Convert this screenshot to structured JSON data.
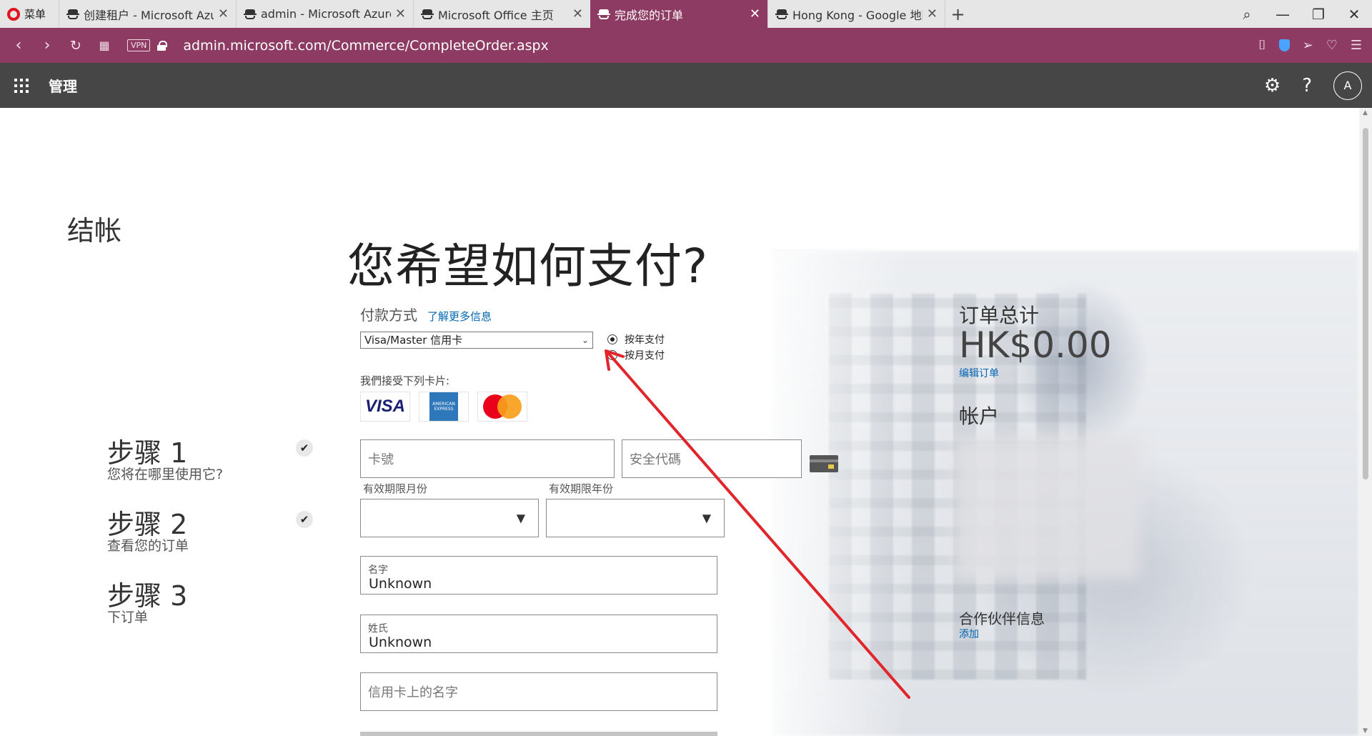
{
  "browser": {
    "menu_label": "菜单",
    "tabs": [
      {
        "title": "创建租户 - Microsoft Azure",
        "active": false
      },
      {
        "title": "admin - Microsoft Azure",
        "active": false
      },
      {
        "title": "Microsoft Office 主页",
        "active": false
      },
      {
        "title": "完成您的订单",
        "active": true
      },
      {
        "title": "Hong Kong - Google 地图",
        "active": false
      }
    ],
    "vpn_label": "VPN",
    "url": "admin.microsoft.com/Commerce/CompleteOrder.aspx",
    "accent_color": "#8e3b63"
  },
  "admin_header": {
    "title": "管理",
    "avatar_initial": "A",
    "background_color": "#464646"
  },
  "checkout": {
    "title": "结帐",
    "steps": [
      {
        "label": "步骤 1",
        "desc": "您将在哪里使用它?",
        "completed": true
      },
      {
        "label": "步骤 2",
        "desc": "查看您的订单",
        "completed": true
      },
      {
        "label": "步骤 3",
        "desc": "下订单",
        "completed": false
      }
    ]
  },
  "payment": {
    "question": "您希望如何支付?",
    "method_label": "付款方式",
    "learn_more": "了解更多信息",
    "method_selected": "Visa/Master 信用卡",
    "billing_options": [
      {
        "label": "按年支付",
        "selected": true
      },
      {
        "label": "按月支付",
        "selected": false
      }
    ],
    "accepted_cards_label": "我們接受下列卡片:",
    "cards": [
      "VISA",
      "AMERICAN EXPRESS",
      "Mastercard"
    ],
    "card_number_placeholder": "卡號",
    "security_code_placeholder": "安全代碼",
    "expiry_month_label": "有效期限月份",
    "expiry_year_label": "有效期限年份",
    "first_name_label": "名字",
    "first_name_value": "Unknown",
    "last_name_label": "姓氏",
    "last_name_value": "Unknown",
    "name_on_card_placeholder": "信用卡上的名字"
  },
  "summary": {
    "order_total_label": "订单总计",
    "order_total_value": "HK$0.00",
    "edit_order": "编辑订单",
    "account_label": "帐户",
    "partner_label": "合作伙伴信息",
    "partner_add": "添加"
  },
  "link_color": "#0066b3",
  "annotation_arrow_color": "#e0262b"
}
